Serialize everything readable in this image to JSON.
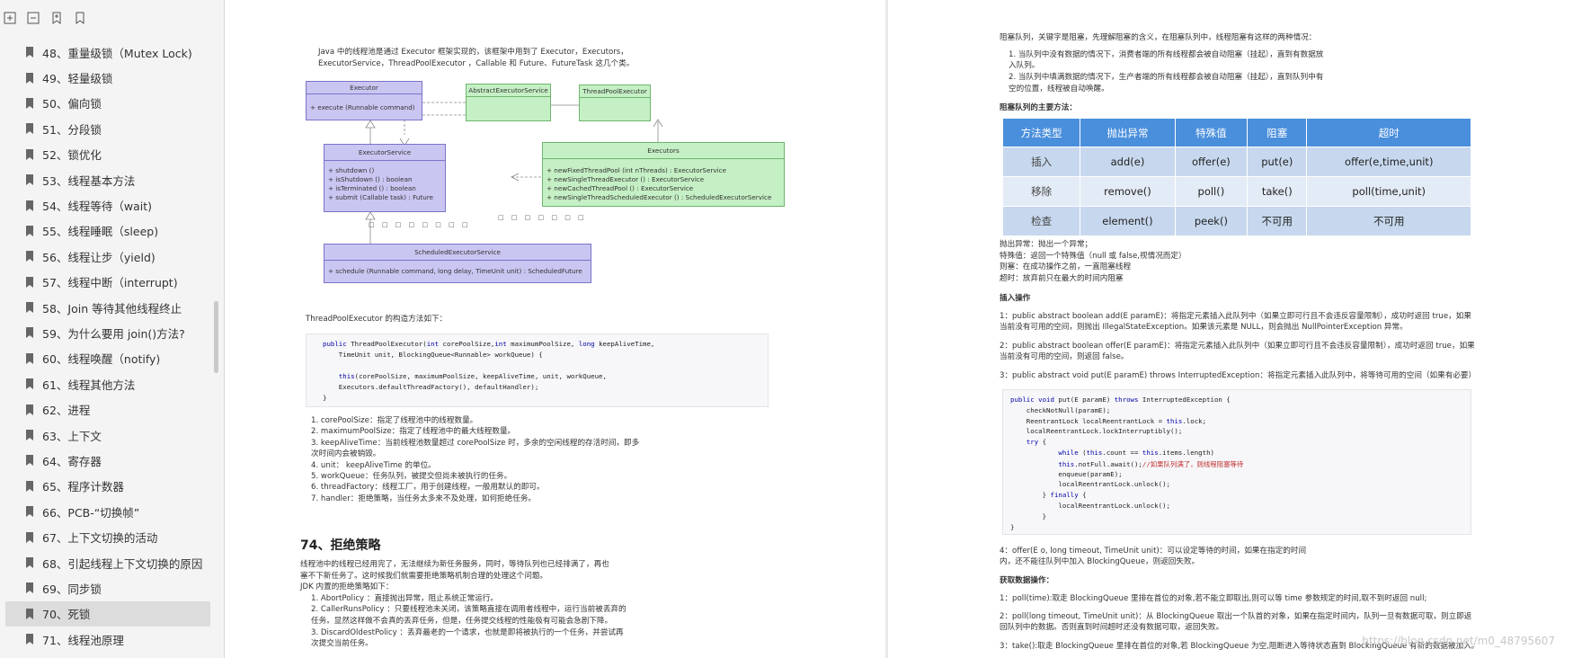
{
  "sidebar": {
    "toolbar_icons": [
      "expand-icon",
      "collapse-icon",
      "bookmark-add-icon",
      "bookmark-icon"
    ],
    "items": [
      "48、重量级锁（Mutex Lock)",
      "49、轻量级锁",
      "50、偏向锁",
      "51、分段锁",
      "52、锁优化",
      "53、线程基本方法",
      "54、线程等待（wait)",
      "55、线程睡眠（sleep)",
      "56、线程让步（yield)",
      "57、线程中断（interrupt)",
      "58、Join 等待其他线程终止",
      "59、为什么要用 join()方法?",
      "60、线程唤醒（notify)",
      "61、线程其他方法",
      "62、进程",
      "63、上下文",
      "64、寄存器",
      "65、程序计数器",
      "66、PCB-“切换帧”",
      "67、上下文切换的活动",
      "68、引起线程上下文切换的原因",
      "69、同步锁",
      "70、死锁",
      "71、线程池原理"
    ],
    "active_index": 22
  },
  "left": {
    "intro1": "Java 中的线程池是通过 Executor 框架实现的，该框架中用到了 Executor，Executors，",
    "intro2": "ExecutorService，ThreadPoolExecutor ，Callable 和 Future、FutureTask 这几个类。",
    "uml": {
      "executor_title": "Executor",
      "executor_body": "+  execute (Runnable command)",
      "abstract_title": "AbstractExecutorService",
      "tpe_title": "ThreadPoolExecutor",
      "es_title": "ExecutorService",
      "es_l1": "+  shutdown ()",
      "es_l2": "+  isShutdown ()                : boolean",
      "es_l3": "+  isTerminated ()              : boolean",
      "es_l4": "+  submit (Callable task)   : Future",
      "executors_title": "Executors",
      "ex_l1": "+  newFixedThreadPool (int nThreads)              : ExecutorService",
      "ex_l2": "+  newSingleThreadExecutor ()                         : ExecutorService",
      "ex_l3": "+  newCachedThreadPool ()                              : ExecutorService",
      "ex_l4": "+  newSingleThreadScheduledExecutor ()  : ScheduledExecutorService",
      "dots1": "□ □ □ □ □ □ □ □",
      "dots2": "□ □ □ □ □ □ □",
      "ses_title": "ScheduledExecutorService",
      "ses_body": "+  schedule (Runnable command, long delay, TimeUnit unit)   : ScheduledFuture"
    },
    "ctor_intro": "ThreadPoolExecutor 的构造方法如下：",
    "code": [
      "public ThreadPoolExecutor(int corePoolSize,int maximumPoolSize, long keepAliveTime,",
      "    TimeUnit unit, BlockingQueue<Runnable> workQueue) {",
      "",
      "    this(corePoolSize, maximumPoolSize, keepAliveTime, unit, workQueue,",
      "    Executors.defaultThreadFactory(), defaultHandler);",
      "}"
    ],
    "params": [
      "1. corePoolSize：指定了线程池中的线程数量。",
      "2. maximumPoolSize：指定了线程池中的最大线程数量。",
      "3. keepAliveTime：当前线程池数量超过 corePoolSize 时，多余的空闲线程的存活时间，即多",
      "    次时间内会被销毁。",
      "4. unit： keepAliveTime 的单位。",
      "5. workQueue：任务队列，被提交但尚未被执行的任务。",
      "6. threadFactory：线程工厂，用于创建线程，一般用默认的即可。",
      "7. handler：拒绝策略，当任务太多来不及处理，如何拒绝任务。"
    ],
    "h74": "74、拒绝策略",
    "reject": [
      "线程池中的线程已经用完了，无法继续为新任务服务，同时，等待队列也已经排满了，再也",
      "塞不下新任务了。这时候我们就需要拒绝策略机制合理的处理这个问题。",
      "JDK 内置的拒绝策略如下：",
      "1. AbortPolicy ：直接抛出异常，阻止系统正常运行。",
      "2. CallerRunsPolicy ：只要线程池未关闭，该策略直接在调用者线程中，运行当前被丢弃的",
      "    任务。显然这样做不会真的丢弃任务，但是，任务提交线程的性能极有可能会急剧下降。",
      "3. DiscardOldestPolicy ：丢弃最老的一个请求，也就是即将被执行的一个任务，并尝试再",
      "    次提交当前任务。"
    ]
  },
  "right": {
    "p1": "阻塞队列，关键字是阻塞，先理解阻塞的含义，在阻塞队列中，线程阻塞有这样的两种情况：",
    "p2": "1. 当队列中没有数据的情况下，消费者端的所有线程都会被自动阻塞（挂起），直到有数据放",
    "p3": "    入队列。",
    "p4": "2. 当队列中填满数据的情况下，生产者端的所有线程都会被自动阻塞（挂起），直到队列中有",
    "p5": "    空的位置，线程被自动唤醒。",
    "methods_title": "阻塞队列的主要方法：",
    "table": {
      "headers": [
        "方法类型",
        "抛出异常",
        "特殊值",
        "阻塞",
        "超时"
      ],
      "rows": [
        [
          "插入",
          "add(e)",
          "offer(e)",
          "put(e)",
          "offer(e,time,unit)"
        ],
        [
          "移除",
          "remove()",
          "poll()",
          "take()",
          "poll(time,unit)"
        ],
        [
          "检查",
          "element()",
          "peek()",
          "不可用",
          "不可用"
        ]
      ]
    },
    "notes": [
      "抛出异常：抛出一个异常；",
      "特殊值：返回一个特殊值（null 或 false,视情况而定）",
      "则塞：在成功操作之前，一直阻塞线程",
      "超时：放弃前只在最大的时间内阻塞"
    ],
    "insert_title": "插入操作",
    "ins1a": "1：public abstract boolean add(E paramE)：将指定元素插入此队列中（如果立即可行且不会违反容量限制），成功时返回 true，如果",
    "ins1b": "当前没有可用的空间，则抛出 IllegalStateException。如果该元素是 NULL，则会抛出 NullPointerException 异常。",
    "ins2a": "2：public abstract boolean offer(E paramE)：将指定元素插入此队列中（如果立即可行且不会违反容量限制），成功时返回 true，如果",
    "ins2b": "当前没有可用的空间，则返回 false。",
    "ins3": "3：public abstract void put(E paramE) throws InterruptedException：将指定元素插入此队列中，将等待可用的空间（如果有必要）",
    "code": [
      "public void put(E paramE) throws InterruptedException {",
      "    checkNotNull(paramE);",
      "    ReentrantLock localReentrantLock = this.lock;",
      "    localReentrantLock.lockInterruptibly();",
      "    try {",
      "            while (this.count == this.items.length)",
      "            this.notFull.await();//如果队列满了，则线程阻塞等待",
      "            enqueue(paramE);",
      "            localReentrantLock.unlock();",
      "        } finally {",
      "            localReentrantLock.unlock();",
      "        }",
      "}"
    ],
    "ins4a": "4：offer(E o, long timeout, TimeUnit unit)：可以设定等待的时间，如果在指定的时间",
    "ins4b": "内，还不能往队列中加入 BlockingQueue，则返回失败。",
    "get_title": "获取数据操作：",
    "get1": "1：poll(time):取走 BlockingQueue 里排在首位的对象,若不能立即取出,则可以等 time 参数规定的时间,取不到时返回 null;",
    "get2a": "2：poll(long timeout, TimeUnit unit)：从 BlockingQueue 取出一个队首的对象，如果在指定时间内，队列一旦有数据可取，则立即返",
    "get2b": "回队列中的数据。否则直到时间超时还没有数据可取，返回失败。",
    "get3": "3：take():取走 BlockingQueue 里排在首位的对象,若 BlockingQueue 为空,阻断进入等待状态直到 BlockingQueue 有新的数据被加入。"
  },
  "watermark": "https://blog.csdn.net/m0_48795607"
}
